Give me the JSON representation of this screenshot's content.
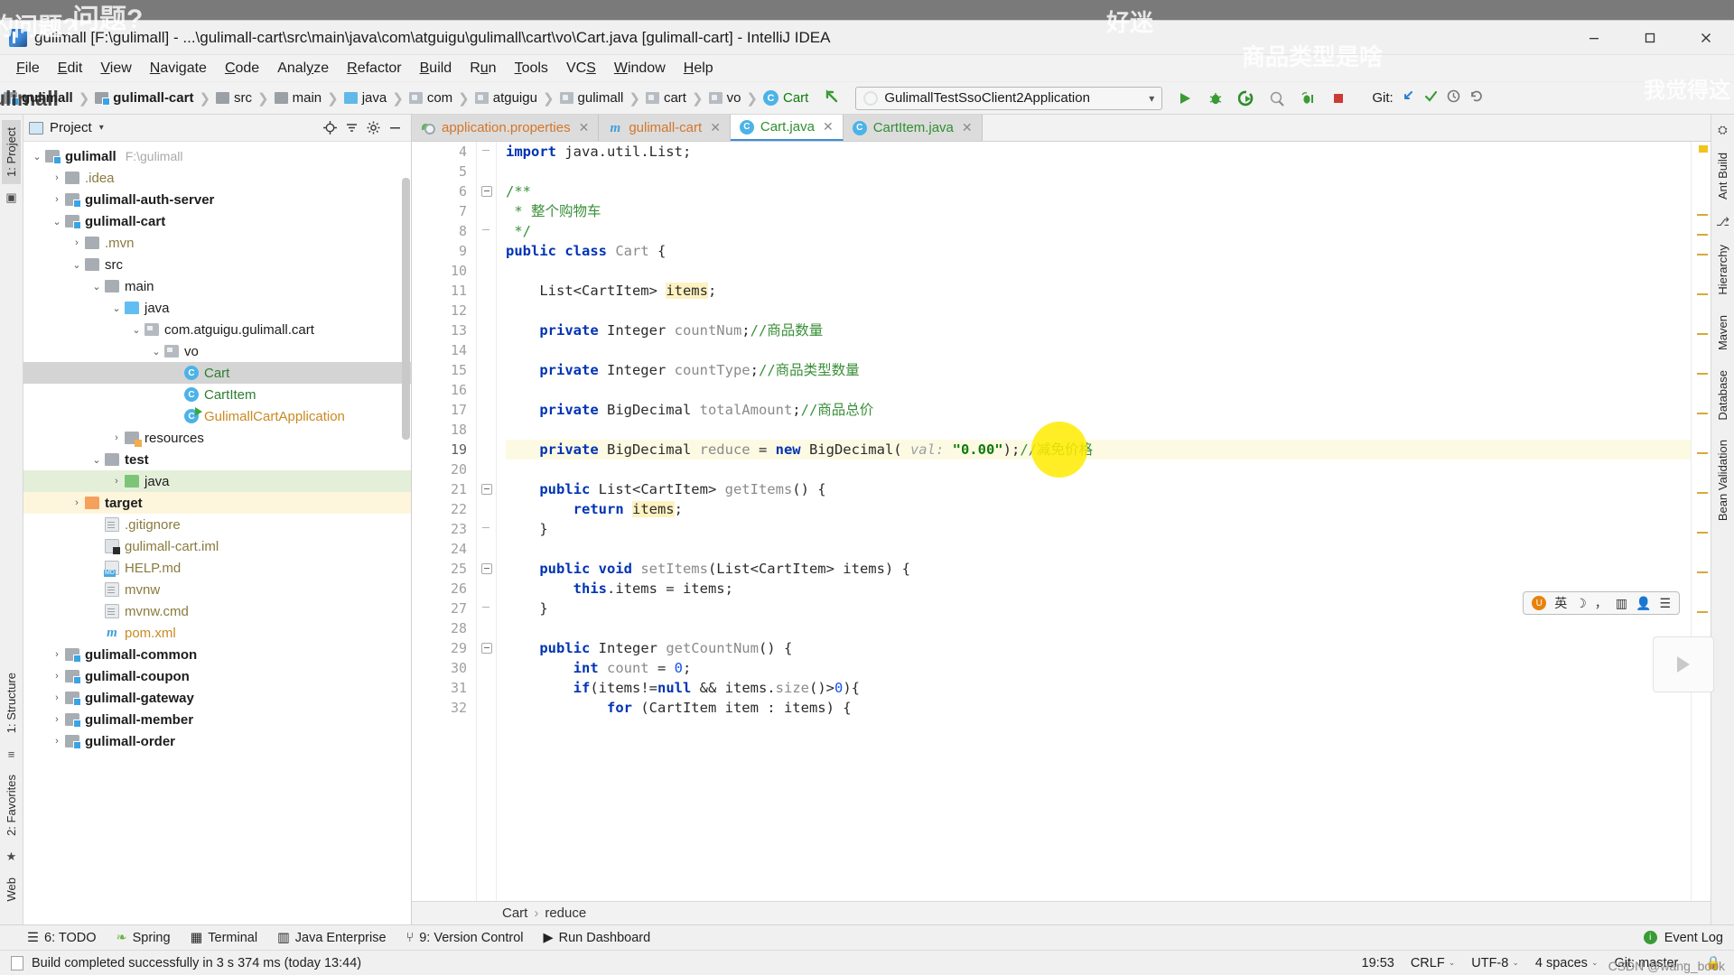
{
  "window": {
    "title": "gulimall [F:\\gulimall] - ...\\gulimall-cart\\src\\main\\java\\com\\atguigu\\gulimall\\cart\\vo\\Cart.java [gulimall-cart] - IntelliJ IDEA",
    "minimize_label": "minimize-icon",
    "maximize_label": "restore-icon",
    "close_label": "close-icon"
  },
  "overlays": {
    "top_left": "问题?",
    "top_left2": "的问题?",
    "center_top": "好迷",
    "center_top2": "商品类型是啥",
    "right_top": "我觉得这",
    "left_edge": "ulimall",
    "csdn": "CSDN @wang_book"
  },
  "menu": [
    {
      "label": "File",
      "mnemonic": "F"
    },
    {
      "label": "Edit",
      "mnemonic": "E"
    },
    {
      "label": "View",
      "mnemonic": "V"
    },
    {
      "label": "Navigate",
      "mnemonic": "N"
    },
    {
      "label": "Code",
      "mnemonic": "C"
    },
    {
      "label": "Analyze",
      "mnemonic": "y"
    },
    {
      "label": "Refactor",
      "mnemonic": "R"
    },
    {
      "label": "Build",
      "mnemonic": "B"
    },
    {
      "label": "Run",
      "mnemonic": "u"
    },
    {
      "label": "Tools",
      "mnemonic": "T"
    },
    {
      "label": "VCS",
      "mnemonic": "S"
    },
    {
      "label": "Window",
      "mnemonic": "W"
    },
    {
      "label": "Help",
      "mnemonic": "H"
    }
  ],
  "navbar": {
    "crumbs": [
      {
        "label": "gulimall",
        "type": "module",
        "bold": true
      },
      {
        "label": "gulimall-cart",
        "type": "module",
        "bold": true
      },
      {
        "label": "src",
        "type": "folder-gray",
        "bold": false
      },
      {
        "label": "main",
        "type": "folder-gray",
        "bold": false
      },
      {
        "label": "java",
        "type": "folder-blue",
        "bold": false
      },
      {
        "label": "com",
        "type": "package",
        "bold": false
      },
      {
        "label": "atguigu",
        "type": "package",
        "bold": false
      },
      {
        "label": "gulimall",
        "type": "package",
        "bold": false
      },
      {
        "label": "cart",
        "type": "package",
        "bold": false
      },
      {
        "label": "vo",
        "type": "package",
        "bold": false
      },
      {
        "label": "Cart",
        "type": "class",
        "bold": false
      }
    ],
    "run_config": "GulimallTestSsoClient2Application",
    "run_config_chevron": "▾",
    "buttons": [
      {
        "name": "run-button",
        "glyph": "▶"
      },
      {
        "name": "debug-button",
        "glyph": "🐞"
      },
      {
        "name": "run-with-coverage-button",
        "glyph": "▶"
      },
      {
        "name": "profile-button",
        "glyph": "◉"
      },
      {
        "name": "attach-debugger-button",
        "glyph": "⚟"
      },
      {
        "name": "stop-button",
        "glyph": "■"
      }
    ],
    "git_label": "Git:",
    "git_buttons": [
      {
        "name": "update-project-button",
        "glyph": "↙"
      },
      {
        "name": "commit-button",
        "glyph": "✔"
      },
      {
        "name": "history-button",
        "glyph": "🕘"
      },
      {
        "name": "rollback-button",
        "glyph": "↺"
      }
    ]
  },
  "left_strip": [
    {
      "label": "1: Project",
      "active": true,
      "name": "tool-window-project"
    },
    {
      "label": "2: Favorites",
      "active": false,
      "name": "tool-window-favorites"
    },
    {
      "label": "1: Structure",
      "active": false,
      "name": "tool-window-structure"
    },
    {
      "label": "Web",
      "active": false,
      "name": "tool-window-web"
    }
  ],
  "right_strip": [
    {
      "label": "Ant Build",
      "name": "tool-window-ant-build"
    },
    {
      "label": "Hierarchy",
      "name": "tool-window-hierarchy"
    },
    {
      "label": "Maven",
      "name": "tool-window-maven"
    },
    {
      "label": "Database",
      "name": "tool-window-database"
    },
    {
      "label": "Bean Validation",
      "name": "tool-window-bean-validation"
    }
  ],
  "project_panel": {
    "title": "Project",
    "caret": "▾",
    "actions": [
      "locate-icon",
      "collapse-all-icon",
      "settings-icon",
      "hide-icon"
    ],
    "tree": [
      {
        "indent": 0,
        "twist": "⌄",
        "icon": "module",
        "label": "gulimall",
        "bold": true,
        "path": "F:\\gulimall",
        "state": "normal"
      },
      {
        "indent": 1,
        "twist": "›",
        "icon": "folder-gray",
        "label": ".idea",
        "bold": false,
        "color": "olive",
        "state": "normal"
      },
      {
        "indent": 1,
        "twist": "›",
        "icon": "module",
        "label": "gulimall-auth-server",
        "bold": true,
        "state": "normal"
      },
      {
        "indent": 1,
        "twist": "⌄",
        "icon": "module",
        "label": "gulimall-cart",
        "bold": true,
        "state": "normal"
      },
      {
        "indent": 2,
        "twist": "›",
        "icon": "folder-gray",
        "label": ".mvn",
        "bold": false,
        "color": "olive",
        "state": "normal"
      },
      {
        "indent": 2,
        "twist": "⌄",
        "icon": "folder-gray",
        "label": "src",
        "bold": false,
        "state": "normal"
      },
      {
        "indent": 3,
        "twist": "⌄",
        "icon": "folder-gray",
        "label": "main",
        "bold": false,
        "state": "normal"
      },
      {
        "indent": 4,
        "twist": "⌄",
        "icon": "folder-blue",
        "label": "java",
        "bold": false,
        "state": "normal"
      },
      {
        "indent": 5,
        "twist": "⌄",
        "icon": "package",
        "label": "com.atguigu.gulimall.cart",
        "bold": false,
        "state": "normal"
      },
      {
        "indent": 6,
        "twist": "⌄",
        "icon": "package",
        "label": "vo",
        "bold": false,
        "state": "normal"
      },
      {
        "indent": 7,
        "twist": "",
        "icon": "class",
        "label": "Cart",
        "bold": false,
        "color": "green",
        "state": "selected"
      },
      {
        "indent": 7,
        "twist": "",
        "icon": "class",
        "label": "CartItem",
        "bold": false,
        "color": "green",
        "state": "normal"
      },
      {
        "indent": 7,
        "twist": "",
        "icon": "runnable-class",
        "label": "GulimallCartApplication",
        "bold": false,
        "color": "orange",
        "state": "normal"
      },
      {
        "indent": 4,
        "twist": "›",
        "icon": "folder-res",
        "label": "resources",
        "bold": false,
        "state": "normal"
      },
      {
        "indent": 3,
        "twist": "⌄",
        "icon": "folder-gray",
        "label": "test",
        "bold": true,
        "state": "normal"
      },
      {
        "indent": 4,
        "twist": "›",
        "icon": "folder-green",
        "label": "java",
        "bold": false,
        "state": "green-bg"
      },
      {
        "indent": 2,
        "twist": "›",
        "icon": "folder-orange",
        "label": "target",
        "bold": true,
        "state": "cream-bg"
      },
      {
        "indent": 3,
        "twist": "",
        "icon": "file",
        "label": ".gitignore",
        "bold": false,
        "color": "olive",
        "state": "normal"
      },
      {
        "indent": 3,
        "twist": "",
        "icon": "file-iml",
        "label": "gulimall-cart.iml",
        "bold": false,
        "color": "olive",
        "state": "normal"
      },
      {
        "indent": 3,
        "twist": "",
        "icon": "file-md",
        "label": "HELP.md",
        "bold": false,
        "color": "olive",
        "state": "normal"
      },
      {
        "indent": 3,
        "twist": "",
        "icon": "file",
        "label": "mvnw",
        "bold": false,
        "color": "olive",
        "state": "normal"
      },
      {
        "indent": 3,
        "twist": "",
        "icon": "file",
        "label": "mvnw.cmd",
        "bold": false,
        "color": "olive",
        "state": "normal"
      },
      {
        "indent": 3,
        "twist": "",
        "icon": "maven",
        "label": "pom.xml",
        "bold": false,
        "color": "orange",
        "state": "normal"
      },
      {
        "indent": 1,
        "twist": "›",
        "icon": "module",
        "label": "gulimall-common",
        "bold": true,
        "state": "normal"
      },
      {
        "indent": 1,
        "twist": "›",
        "icon": "module",
        "label": "gulimall-coupon",
        "bold": true,
        "state": "normal"
      },
      {
        "indent": 1,
        "twist": "›",
        "icon": "module",
        "label": "gulimall-gateway",
        "bold": true,
        "state": "normal"
      },
      {
        "indent": 1,
        "twist": "›",
        "icon": "module",
        "label": "gulimall-member",
        "bold": true,
        "state": "normal"
      },
      {
        "indent": 1,
        "twist": "›",
        "icon": "module",
        "label": "gulimall-order",
        "bold": true,
        "state": "normal"
      }
    ]
  },
  "editor": {
    "tabs": [
      {
        "label": "application.properties",
        "icon": "properties-icon",
        "kind": "props",
        "active": false,
        "closable": true
      },
      {
        "label": "gulimall-cart",
        "icon": "maven-icon",
        "kind": "pom",
        "active": false,
        "closable": true
      },
      {
        "label": "Cart.java",
        "icon": "class-icon",
        "kind": "java",
        "active": true,
        "closable": true
      },
      {
        "label": "CartItem.java",
        "icon": "class-icon",
        "kind": "java",
        "active": false,
        "closable": true
      }
    ],
    "first_line_number": 4,
    "lines": [
      {
        "n": 4,
        "fold": "end",
        "segments": [
          {
            "t": "import ",
            "c": "kw"
          },
          {
            "t": "java.util.List;",
            "c": "plain"
          }
        ]
      },
      {
        "n": 5,
        "fold": "",
        "segments": []
      },
      {
        "n": 6,
        "fold": "start",
        "segments": [
          {
            "t": "/**",
            "c": "comment"
          }
        ]
      },
      {
        "n": 7,
        "fold": "",
        "segments": [
          {
            "t": " * 整个购物车",
            "c": "comment"
          }
        ]
      },
      {
        "n": 8,
        "fold": "end",
        "segments": [
          {
            "t": " */",
            "c": "comment"
          }
        ]
      },
      {
        "n": 9,
        "fold": "",
        "segments": [
          {
            "t": "public class ",
            "c": "kw"
          },
          {
            "t": "Cart ",
            "c": "type"
          },
          {
            "t": "{",
            "c": "plain"
          }
        ]
      },
      {
        "n": 10,
        "fold": "",
        "segments": []
      },
      {
        "n": 11,
        "fold": "",
        "segments": [
          {
            "t": "    List<CartItem> ",
            "c": "plain"
          },
          {
            "t": "items",
            "c": "fieldhl"
          },
          {
            "t": ";",
            "c": "plain"
          }
        ]
      },
      {
        "n": 12,
        "fold": "",
        "segments": []
      },
      {
        "n": 13,
        "fold": "",
        "segments": [
          {
            "t": "    private ",
            "c": "kw"
          },
          {
            "t": "Integer ",
            "c": "plain"
          },
          {
            "t": "countNum",
            "c": "type"
          },
          {
            "t": ";",
            "c": "plain"
          },
          {
            "t": "//商品数量",
            "c": "comment"
          }
        ]
      },
      {
        "n": 14,
        "fold": "",
        "segments": []
      },
      {
        "n": 15,
        "fold": "",
        "segments": [
          {
            "t": "    private ",
            "c": "kw"
          },
          {
            "t": "Integer ",
            "c": "plain"
          },
          {
            "t": "countType",
            "c": "type"
          },
          {
            "t": ";",
            "c": "plain"
          },
          {
            "t": "//商品类型数量",
            "c": "comment"
          }
        ]
      },
      {
        "n": 16,
        "fold": "",
        "segments": []
      },
      {
        "n": 17,
        "fold": "",
        "segments": [
          {
            "t": "    private ",
            "c": "kw"
          },
          {
            "t": "BigDecimal ",
            "c": "plain"
          },
          {
            "t": "totalAmount",
            "c": "type"
          },
          {
            "t": ";",
            "c": "plain"
          },
          {
            "t": "//商品总价",
            "c": "comment"
          }
        ]
      },
      {
        "n": 18,
        "fold": "",
        "segments": []
      },
      {
        "n": 19,
        "fold": "",
        "highlight": true,
        "segments": [
          {
            "t": "    private ",
            "c": "kw"
          },
          {
            "t": "BigDecimal ",
            "c": "plain"
          },
          {
            "t": "reduce",
            "c": "type"
          },
          {
            "t": " = ",
            "c": "plain"
          },
          {
            "t": "new ",
            "c": "kw"
          },
          {
            "t": "BigDecimal(",
            "c": "plain"
          },
          {
            "t": " val:",
            "c": "param-hint"
          },
          {
            "t": " ",
            "c": "plain"
          },
          {
            "t": "\"0.00\"",
            "c": "str"
          },
          {
            "t": ");",
            "c": "plain"
          },
          {
            "t": "//减免价格",
            "c": "comment"
          }
        ]
      },
      {
        "n": 20,
        "fold": "",
        "segments": []
      },
      {
        "n": 21,
        "fold": "start",
        "segments": [
          {
            "t": "    public ",
            "c": "kw"
          },
          {
            "t": "List<CartItem> ",
            "c": "plain"
          },
          {
            "t": "getItems",
            "c": "type"
          },
          {
            "t": "() {",
            "c": "plain"
          }
        ]
      },
      {
        "n": 22,
        "fold": "",
        "segments": [
          {
            "t": "        return ",
            "c": "kw"
          },
          {
            "t": "items",
            "c": "fieldhl2"
          },
          {
            "t": ";",
            "c": "plain"
          }
        ]
      },
      {
        "n": 23,
        "fold": "end",
        "segments": [
          {
            "t": "    }",
            "c": "plain"
          }
        ]
      },
      {
        "n": 24,
        "fold": "",
        "segments": []
      },
      {
        "n": 25,
        "fold": "start",
        "segments": [
          {
            "t": "    public void ",
            "c": "kw"
          },
          {
            "t": "setItems",
            "c": "type"
          },
          {
            "t": "(List<CartItem> items) {",
            "c": "plain"
          }
        ]
      },
      {
        "n": 26,
        "fold": "",
        "segments": [
          {
            "t": "        this",
            "c": "kw"
          },
          {
            "t": ".items = items;",
            "c": "plain"
          }
        ]
      },
      {
        "n": 27,
        "fold": "end",
        "segments": [
          {
            "t": "    }",
            "c": "plain"
          }
        ]
      },
      {
        "n": 28,
        "fold": "",
        "segments": []
      },
      {
        "n": 29,
        "fold": "start",
        "segments": [
          {
            "t": "    public ",
            "c": "kw"
          },
          {
            "t": "Integer ",
            "c": "plain"
          },
          {
            "t": "getCountNum",
            "c": "type"
          },
          {
            "t": "() {",
            "c": "plain"
          }
        ]
      },
      {
        "n": 30,
        "fold": "",
        "segments": [
          {
            "t": "        int ",
            "c": "kw"
          },
          {
            "t": "count",
            "c": "type"
          },
          {
            "t": " = ",
            "c": "plain"
          },
          {
            "t": "0",
            "c": "num"
          },
          {
            "t": ";",
            "c": "plain"
          }
        ]
      },
      {
        "n": 31,
        "fold": "",
        "segments": [
          {
            "t": "        if",
            "c": "kw"
          },
          {
            "t": "(items!=",
            "c": "plain"
          },
          {
            "t": "null ",
            "c": "kw"
          },
          {
            "t": "&& items.",
            "c": "plain"
          },
          {
            "t": "size",
            "c": "type"
          },
          {
            "t": "()>",
            "c": "plain"
          },
          {
            "t": "0",
            "c": "num"
          },
          {
            "t": "){",
            "c": "plain"
          }
        ]
      },
      {
        "n": 32,
        "fold": "",
        "segments": [
          {
            "t": "            for ",
            "c": "kw"
          },
          {
            "t": "(CartItem item : items) {",
            "c": "plain"
          }
        ]
      }
    ],
    "caret_highlight_line": 19,
    "breadcrumb": [
      "Cart",
      "reduce"
    ],
    "breadcrumb_sep": "›"
  },
  "bottom_bar": {
    "items": [
      {
        "label": "6: TODO",
        "icon": "todo-icon"
      },
      {
        "label": "Spring",
        "icon": "spring-icon"
      },
      {
        "label": "Terminal",
        "icon": "terminal-icon"
      },
      {
        "label": "Java Enterprise",
        "icon": "java-enterprise-icon"
      },
      {
        "label": "9: Version Control",
        "icon": "version-control-icon"
      },
      {
        "label": "Run Dashboard",
        "icon": "run-dashboard-icon"
      }
    ],
    "event_log": "Event Log"
  },
  "status_bar": {
    "message": "Build completed successfully in 3 s 374 ms (today 13:44)",
    "position": "19:53",
    "line_separator": "CRLF",
    "encoding": "UTF-8",
    "indent": "4 spaces",
    "branch": "Git: master",
    "caret": "⌄"
  },
  "ime": {
    "logo": "U",
    "mode": "英",
    "items": [
      "moon-icon",
      "comma-icon",
      "keyboard-icon",
      "user-icon",
      "menu-icon"
    ]
  },
  "colors": {
    "accent_blue": "#3c8ddb",
    "keyword": "#0033b3",
    "comment_green": "#3a8f3a",
    "string_green": "#0c7a0c",
    "selection_gray": "#d4d4d4",
    "highlight_line": "#fcfae3",
    "caret_yellow": "#ffe400"
  }
}
